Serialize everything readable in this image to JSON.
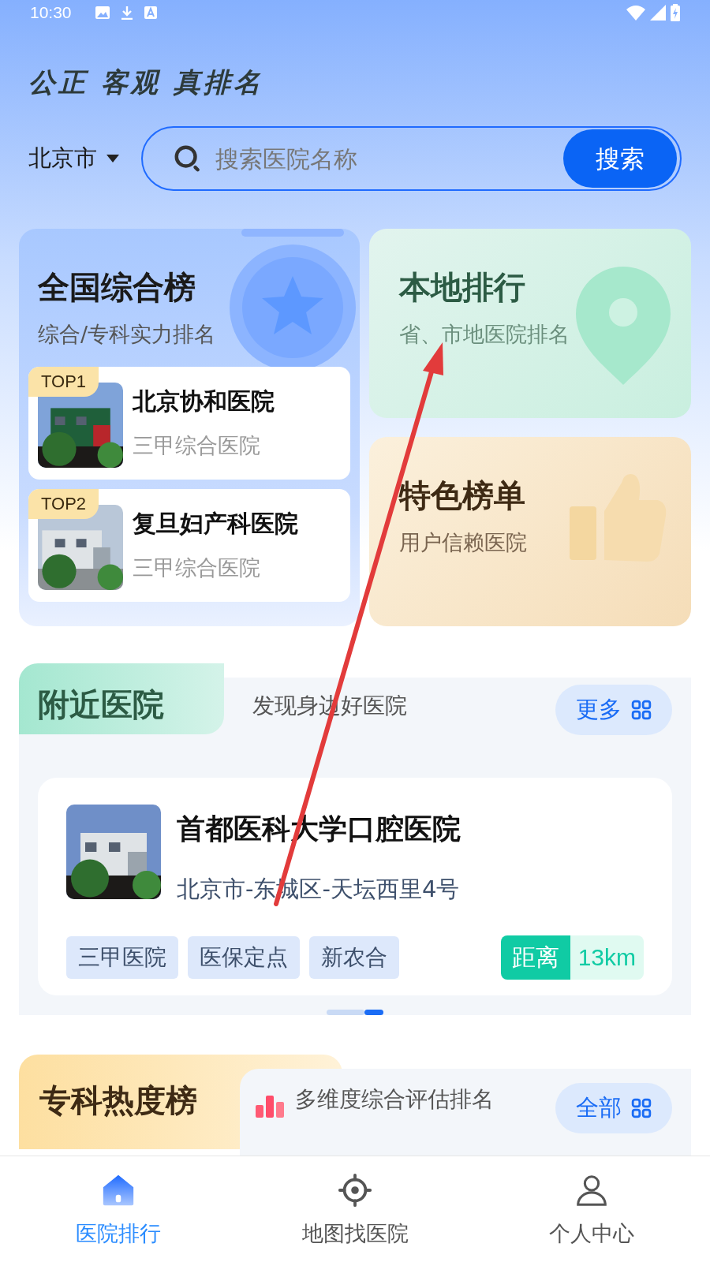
{
  "status_bar": {
    "time": "10:30"
  },
  "slogan": "公正 客观 真排名",
  "city": "北京市",
  "search": {
    "placeholder": "搜索医院名称",
    "button": "搜索"
  },
  "national_card": {
    "title": "全国综合榜",
    "subtitle": "综合/专科实力排名",
    "hospitals": [
      {
        "rank": "TOP1",
        "name": "北京协和医院",
        "level": "三甲综合医院"
      },
      {
        "rank": "TOP2",
        "name": "复旦妇产科医院",
        "level": "三甲综合医院"
      }
    ]
  },
  "local_card": {
    "title": "本地排行",
    "subtitle": "省、市地医院排名"
  },
  "featured_card": {
    "title": "特色榜单",
    "subtitle": "用户信赖医院"
  },
  "nearby": {
    "title": "附近医院",
    "subtitle": "发现身边好医院",
    "more": "更多",
    "hospital": {
      "name": "首都医科大学口腔医院",
      "address": "北京市-东城区-天坛西里4号",
      "tags": [
        "三甲医院",
        "医保定点",
        "新农合"
      ],
      "distance_label": "距离",
      "distance": "13km"
    },
    "pager": [
      {
        "selected": false
      },
      {
        "selected": true
      }
    ]
  },
  "specialty": {
    "title": "专科热度榜",
    "subtitle": "多维度综合评估排名",
    "more": "全部"
  },
  "tab_bar": [
    {
      "label": "医院排行",
      "selected": true
    },
    {
      "label": "地图找医院",
      "selected": false
    },
    {
      "label": "个人中心",
      "selected": false
    }
  ]
}
